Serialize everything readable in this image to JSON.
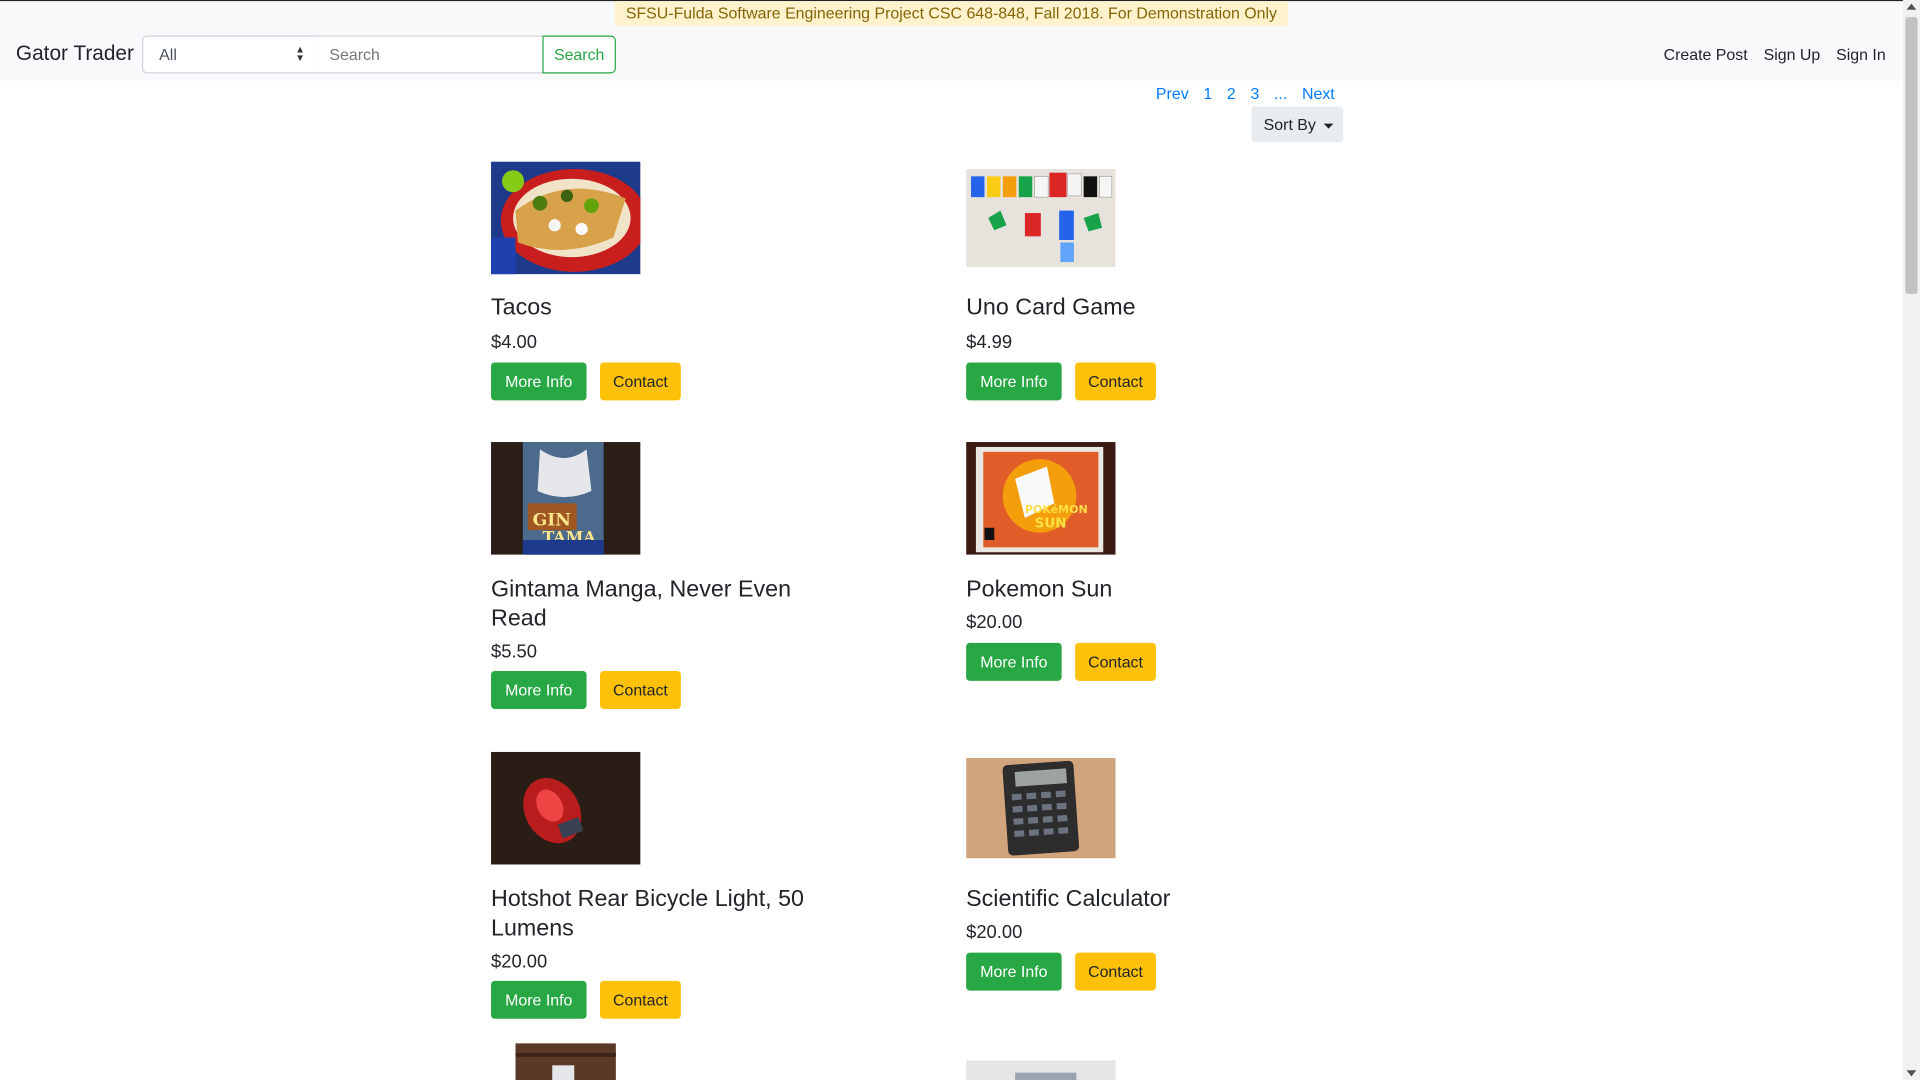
{
  "banner": "SFSU-Fulda Software Engineering Project CSC 648-848, Fall 2018. For Demonstration Only",
  "navbar": {
    "brand": "Gator Trader",
    "category_selected": "All",
    "search_placeholder": "Search",
    "search_button": "Search",
    "links": [
      "Create Post",
      "Sign Up",
      "Sign In"
    ]
  },
  "pagination": {
    "prev": "Prev",
    "pages": [
      "1",
      "2",
      "3"
    ],
    "ellipsis": "...",
    "next": "Next"
  },
  "sort_label": "Sort By",
  "buttons": {
    "more_info": "More Info",
    "contact": "Contact"
  },
  "listings": [
    {
      "title": "Tacos",
      "price": "$4.00",
      "image": "tacos-photo"
    },
    {
      "title": "Uno Card Game",
      "price": "$4.99",
      "image": "uno-cards-photo"
    },
    {
      "title": "Gintama Manga, Never Even Read",
      "price": "$5.50",
      "image": "gintama-manga-photo"
    },
    {
      "title": "Pokemon Sun",
      "price": "$20.00",
      "image": "pokemon-sun-photo"
    },
    {
      "title": "Hotshot Rear Bicycle Light, 50 Lumens",
      "price": "$20.00",
      "image": "bike-light-photo"
    },
    {
      "title": "Scientific Calculator",
      "price": "$20.00",
      "image": "calculator-photo"
    }
  ]
}
